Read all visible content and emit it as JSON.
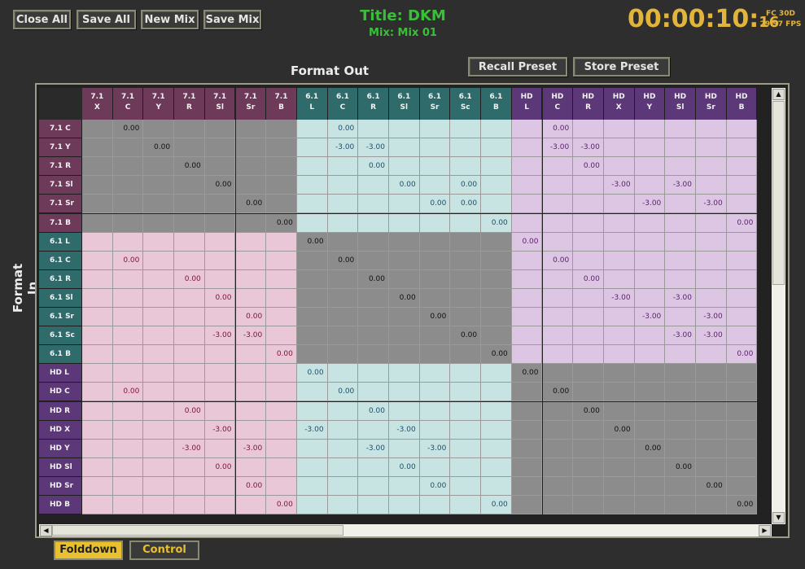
{
  "toolbar": {
    "close_all": "Close All",
    "save_all": "Save All",
    "new_mix": "New Mix",
    "save_mix": "Save Mix"
  },
  "header": {
    "title": "Title: DKM",
    "mix": "Mix: Mix 01",
    "timecode": "00:00:10:",
    "timecode_frames": "16",
    "frame_code": "FC 30D",
    "fps": "29.97 FPS"
  },
  "presets": {
    "recall": "Recall Preset",
    "store": "Store Preset"
  },
  "matrix": {
    "format_out_label": "Format Out",
    "format_in_label": "Format In",
    "columns": [
      {
        "group": "7.1",
        "label": "7.1\nX"
      },
      {
        "group": "7.1",
        "label": "7.1\nC"
      },
      {
        "group": "7.1",
        "label": "7.1\nY"
      },
      {
        "group": "7.1",
        "label": "7.1\nR"
      },
      {
        "group": "7.1",
        "label": "7.1\nSl"
      },
      {
        "group": "7.1",
        "label": "7.1\nSr"
      },
      {
        "group": "7.1",
        "label": "7.1\nB"
      },
      {
        "group": "6.1",
        "label": "6.1\nL"
      },
      {
        "group": "6.1",
        "label": "6.1\nC"
      },
      {
        "group": "6.1",
        "label": "6.1\nR"
      },
      {
        "group": "6.1",
        "label": "6.1\nSl"
      },
      {
        "group": "6.1",
        "label": "6.1\nSr"
      },
      {
        "group": "6.1",
        "label": "6.1\nSc"
      },
      {
        "group": "6.1",
        "label": "6.1\nB"
      },
      {
        "group": "HD",
        "label": "HD\nL"
      },
      {
        "group": "HD",
        "label": "HD\nC"
      },
      {
        "group": "HD",
        "label": "HD\nR"
      },
      {
        "group": "HD",
        "label": "HD\nX"
      },
      {
        "group": "HD",
        "label": "HD\nY"
      },
      {
        "group": "HD",
        "label": "HD\nSl"
      },
      {
        "group": "HD",
        "label": "HD\nSr"
      },
      {
        "group": "HD",
        "label": "HD\nB"
      }
    ],
    "rows": [
      {
        "group": "7.1",
        "label": "7.1 C",
        "cells": {
          "1": "0.00",
          "8": "0.00",
          "15": "0.00"
        }
      },
      {
        "group": "7.1",
        "label": "7.1 Y",
        "cells": {
          "2": "0.00",
          "8": "-3.00",
          "9": "-3.00",
          "15": "-3.00",
          "16": "-3.00"
        }
      },
      {
        "group": "7.1",
        "label": "7.1 R",
        "cells": {
          "3": "0.00",
          "9": "0.00",
          "16": "0.00"
        }
      },
      {
        "group": "7.1",
        "label": "7.1 Sl",
        "cells": {
          "4": "0.00",
          "10": "0.00",
          "12": "0.00",
          "17": "-3.00",
          "19": "-3.00"
        }
      },
      {
        "group": "7.1",
        "label": "7.1 Sr",
        "cells": {
          "5": "0.00",
          "11": "0.00",
          "12": "0.00",
          "18": "-3.00",
          "20": "-3.00"
        }
      },
      {
        "group": "7.1",
        "label": "7.1 B",
        "cells": {
          "6": "0.00",
          "13": "0.00",
          "21": "0.00"
        }
      },
      {
        "group": "6.1",
        "label": "6.1 L",
        "cells": {
          "7": "0.00",
          "14": "0.00"
        }
      },
      {
        "group": "6.1",
        "label": "6.1 C",
        "cells": {
          "1": "0.00",
          "8": "0.00",
          "15": "0.00"
        }
      },
      {
        "group": "6.1",
        "label": "6.1 R",
        "cells": {
          "3": "0.00",
          "9": "0.00",
          "16": "0.00"
        }
      },
      {
        "group": "6.1",
        "label": "6.1 Sl",
        "cells": {
          "4": "0.00",
          "10": "0.00",
          "17": "-3.00",
          "19": "-3.00"
        }
      },
      {
        "group": "6.1",
        "label": "6.1 Sr",
        "cells": {
          "5": "0.00",
          "11": "0.00",
          "18": "-3.00",
          "20": "-3.00"
        }
      },
      {
        "group": "6.1",
        "label": "6.1 Sc",
        "cells": {
          "4": "-3.00",
          "5": "-3.00",
          "12": "0.00",
          "19": "-3.00",
          "20": "-3.00"
        }
      },
      {
        "group": "6.1",
        "label": "6.1 B",
        "cells": {
          "6": "0.00",
          "13": "0.00",
          "21": "0.00"
        }
      },
      {
        "group": "HD",
        "label": "HD L",
        "cells": {
          "7": "0.00",
          "14": "0.00"
        }
      },
      {
        "group": "HD",
        "label": "HD C",
        "cells": {
          "1": "0.00",
          "8": "0.00",
          "15": "0.00"
        }
      },
      {
        "group": "HD",
        "label": "HD R",
        "cells": {
          "3": "0.00",
          "9": "0.00",
          "16": "0.00"
        }
      },
      {
        "group": "HD",
        "label": "HD X",
        "cells": {
          "4": "-3.00",
          "7": "-3.00",
          "10": "-3.00",
          "17": "0.00"
        }
      },
      {
        "group": "HD",
        "label": "HD Y",
        "cells": {
          "3": "-3.00",
          "5": "-3.00",
          "9": "-3.00",
          "11": "-3.00",
          "18": "0.00"
        }
      },
      {
        "group": "HD",
        "label": "HD Sl",
        "cells": {
          "4": "0.00",
          "10": "0.00",
          "19": "0.00"
        }
      },
      {
        "group": "HD",
        "label": "HD Sr",
        "cells": {
          "5": "0.00",
          "11": "0.00",
          "20": "0.00"
        }
      },
      {
        "group": "HD",
        "label": "HD B",
        "cells": {
          "6": "0.00",
          "13": "0.00",
          "21": "0.00"
        }
      }
    ],
    "colors": {
      "header_7.1": "#6e3a5a",
      "header_6.1": "#2f6b6b",
      "header_HD": "#5c3878",
      "diagonal_block": "#8c8c8c",
      "to_7.1": "#e9c7d6",
      "to_6.1": "#c7e4e2",
      "to_HD": "#dcc6e3",
      "value_7.1": "#7a1438",
      "value_6.1": "#1d4f6a",
      "value_HD": "#5a1f6a",
      "value_diag": "#111111"
    }
  },
  "tabs": {
    "folddown": "Folddown",
    "control": "Control"
  }
}
